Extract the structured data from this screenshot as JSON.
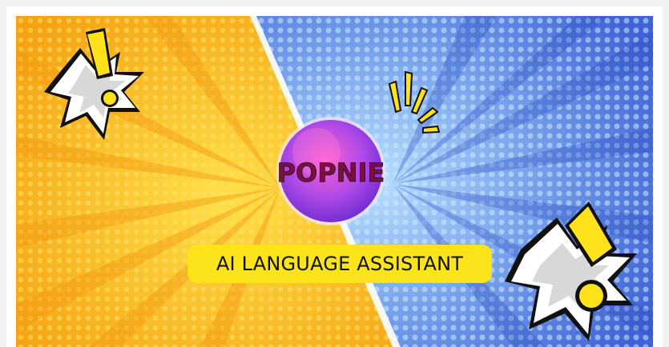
{
  "banner": {
    "logo_text": "POPNIE",
    "tagline": "AI LANGUAGE ASSISTANT"
  },
  "colors": {
    "left_bg": "#f8b21c",
    "left_bg_light": "#ffe04a",
    "right_bg": "#4f78e0",
    "right_bg_light": "#a9d4ff",
    "tagline_bg": "#fbe51a",
    "logo_orb": "#a540e8",
    "logo_text": "#7a1040",
    "burst_yellow": "#ffe21c"
  },
  "icons": [
    "exclamation-burst-icon",
    "exclamation-burst-icon",
    "spark-lines-icon"
  ]
}
